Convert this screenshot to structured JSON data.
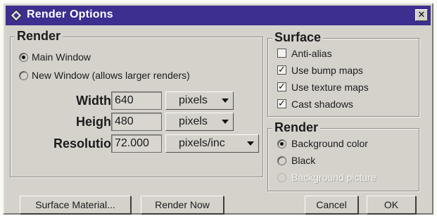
{
  "window": {
    "title": "Render Options",
    "icon": "app-diamond-icon",
    "close_symbol": "✕"
  },
  "render_group": {
    "title": "Render",
    "options": [
      {
        "label": "Main Window",
        "selected": true
      },
      {
        "label": "New Window (allows larger renders)",
        "selected": false
      }
    ],
    "width": {
      "label": "Width",
      "value": "640",
      "unit": "pixels"
    },
    "height": {
      "label": "Heigh",
      "value": "480",
      "unit": "pixels"
    },
    "resolution": {
      "label": "Resolutio",
      "value": "72.000",
      "unit": "pixels/inc"
    }
  },
  "surface_group": {
    "title": "Surface",
    "options": [
      {
        "label": "Anti-alias",
        "checked": false
      },
      {
        "label": "Use bump maps",
        "checked": true
      },
      {
        "label": "Use texture maps",
        "checked": true
      },
      {
        "label": "Cast shadows",
        "checked": true
      }
    ]
  },
  "background_group": {
    "title": "Render",
    "options": [
      {
        "label": "Background color",
        "selected": true,
        "enabled": true
      },
      {
        "label": "Black",
        "selected": false,
        "enabled": true
      },
      {
        "label": "Background picture",
        "selected": false,
        "enabled": false
      }
    ]
  },
  "buttons": {
    "surface_material": "Surface Material...",
    "render_now": "Render Now",
    "cancel": "Cancel",
    "ok": "OK"
  },
  "colors": {
    "titlebar": "#3c2f8f",
    "dialog_face": "#d4d2cb",
    "title_text": "#ffffff"
  }
}
